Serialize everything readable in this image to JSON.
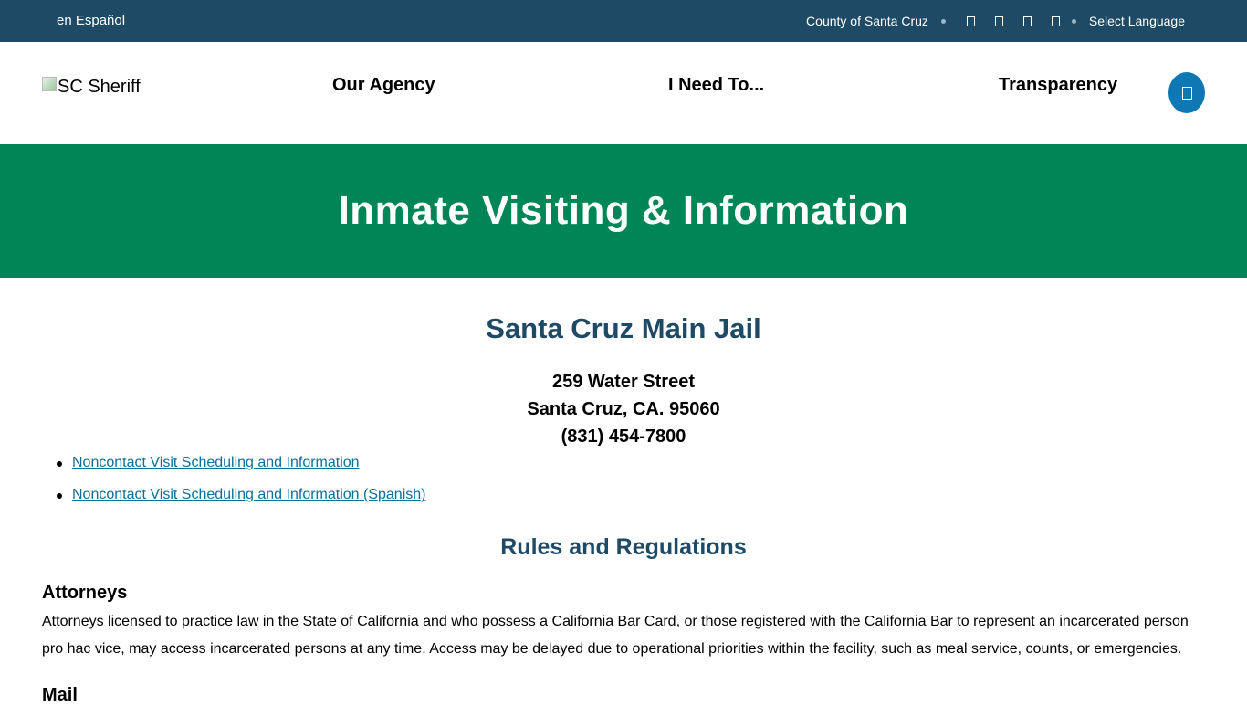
{
  "topbar": {
    "spanish_link": "en Español",
    "county_link": "County of Santa Cruz",
    "social_icons": [
      "facebook-icon",
      "twitter-icon",
      "instagram-icon",
      "youtube-icon"
    ],
    "select_language": "Select Language"
  },
  "header": {
    "logo_alt": "SC Sheriff",
    "nav": {
      "our_agency": "Our Agency",
      "i_need_to": "I Need To...",
      "transparency": "Transparency"
    },
    "search_icon": "search-icon"
  },
  "banner": {
    "title": "Inmate Visiting & Information"
  },
  "main": {
    "jail_title": "Santa Cruz Main Jail",
    "address_line1": "259 Water Street",
    "address_line2": "Santa Cruz, CA. 95060",
    "phone": "(831) 454-7800",
    "links": [
      "Noncontact Visit Scheduling and Information",
      "Noncontact Visit Scheduling and Information (Spanish)"
    ],
    "rules_title": "Rules and Regulations",
    "attorneys_heading": "Attorneys",
    "attorneys_text": "Attorneys licensed to practice law in the State of California and who possess a California Bar Card, or those registered with the California Bar to represent an incarcerated person pro hac vice, may access incarcerated persons at any time. Access may be delayed due to operational priorities within the facility, such as meal service, counts, or emergencies.",
    "mail_heading": "Mail"
  },
  "colors": {
    "topbar": "#1e4a66",
    "banner": "#008556",
    "heading": "#1e4a66",
    "link": "#0e6e9a",
    "search_button": "#0e78b4"
  }
}
